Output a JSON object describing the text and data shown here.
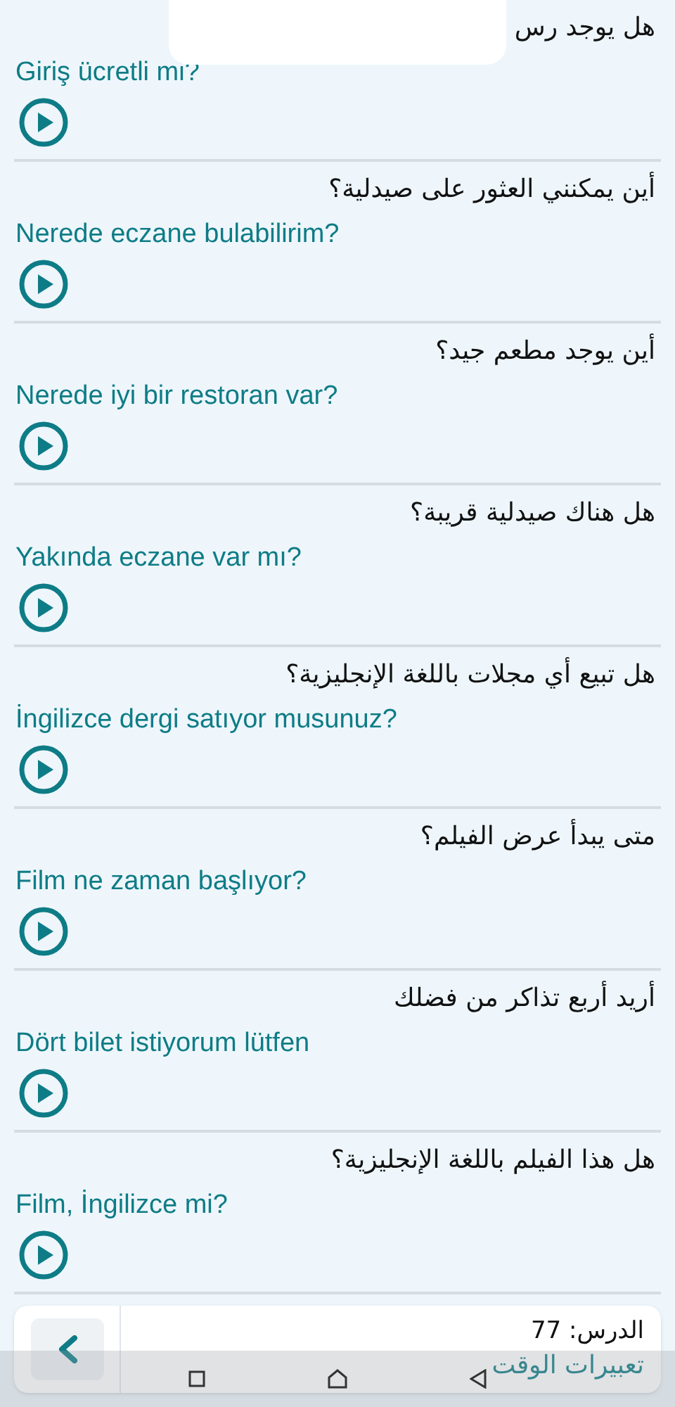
{
  "phrases": [
    {
      "arabic": "هل يوجد رس",
      "turkish": "Giriş ücretli mi?"
    },
    {
      "arabic": "أين يمكنني العثور على صيدلية؟",
      "turkish": "Nerede eczane bulabilirim?"
    },
    {
      "arabic": "أين يوجد مطعم جيد؟",
      "turkish": "Nerede iyi bir restoran var?"
    },
    {
      "arabic": "هل هناك صيدلية قريبة؟",
      "turkish": "Yakında eczane var mı?"
    },
    {
      "arabic": "هل تبيع أي مجلات باللغة الإنجليزية؟",
      "turkish": "İngilizce dergi satıyor musunuz?"
    },
    {
      "arabic": "متى يبدأ عرض الفيلم؟",
      "turkish": "Film ne zaman başlıyor?"
    },
    {
      "arabic": "أريد أربع تذاكر من فضلك",
      "turkish": "Dört bilet istiyorum lütfen"
    },
    {
      "arabic": "هل هذا الفيلم باللغة الإنجليزية؟",
      "turkish": "Film, İngilizce mi?"
    }
  ],
  "footer": {
    "lesson": "الدرس: 77",
    "title": "تعبيرات الوقت"
  }
}
